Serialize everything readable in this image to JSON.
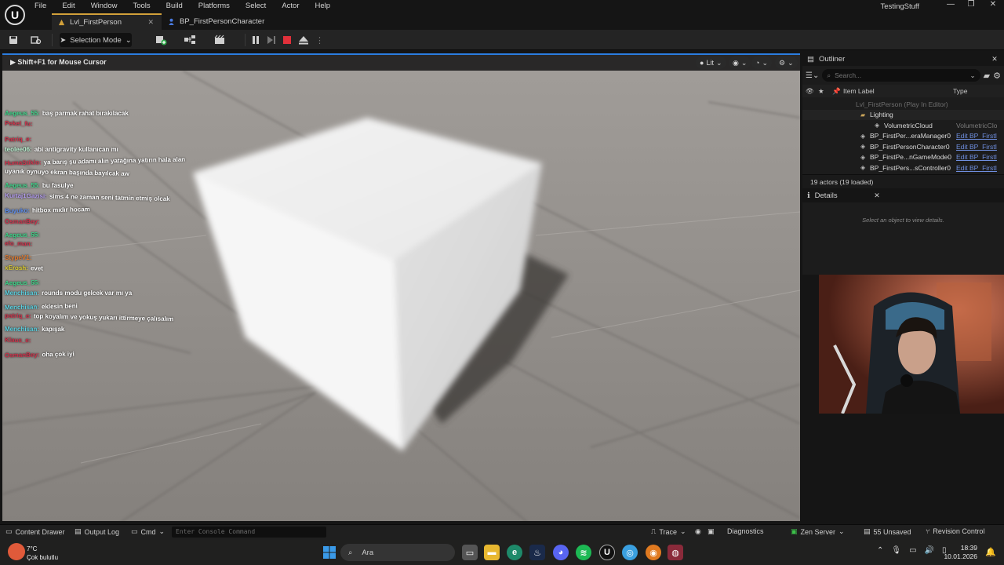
{
  "menu": [
    "File",
    "Edit",
    "Window",
    "Tools",
    "Build",
    "Platforms",
    "Select",
    "Actor",
    "Help"
  ],
  "project_name": "TestingStuff",
  "window_controls": {
    "minimize": "—",
    "maximize": "❐",
    "close": "✕"
  },
  "tabs": [
    {
      "label": "Lvl_FirstPerson",
      "active": true
    },
    {
      "label": "BP_FirstPersonCharacter",
      "active": false
    }
  ],
  "toolbar": {
    "selection_mode": "Selection Mode"
  },
  "viewport": {
    "hint": "Shift+F1 for Mouse Cursor",
    "lit_label": "Lit"
  },
  "chat": [
    {
      "user": "Aegeus_55:",
      "msg": "baş parmak rahat bırakılacak",
      "color": "#3cd68a"
    },
    {
      "user": "Pekel_fu:",
      "msg": "",
      "color": "#d0304a"
    },
    {
      "user": "Patriq_e:",
      "msg": "",
      "color": "#d0304a"
    },
    {
      "user": "teolee06:",
      "msg": "abi antigravity kullanıcan mı",
      "color": "#b9f0d0"
    },
    {
      "user": "HumaStiklo:",
      "msg": "ya barış şu adamı alın yatağına yatırın hala alan",
      "color": "#d0304a"
    },
    {
      "user": "",
      "msg": "uyanık oynuyo ekran başında bayılcak aw",
      "color": "#ffffff"
    },
    {
      "user": "Aegeus_55:",
      "msg": "bu fasulye",
      "color": "#3cd68a"
    },
    {
      "user": "Kurtaj1Gazisi:",
      "msg": "sims 4 ne zaman seni tatmin etmiş olcak",
      "color": "#b39cf0"
    },
    {
      "user": "Buyuko:",
      "msg": "hitbox mıdır hocam",
      "color": "#5a8cf0"
    },
    {
      "user": "OsmanBey:",
      "msg": "",
      "color": "#d0304a"
    },
    {
      "user": "Aegeus_55:",
      "msg": "",
      "color": "#3cd68a"
    },
    {
      "user": "elo_man:",
      "msg": "",
      "color": "#d0304a"
    },
    {
      "user": "StypeV1:",
      "msg": "",
      "color": "#e07a30"
    },
    {
      "user": "xErosh:",
      "msg": "evet",
      "color": "#e0d030"
    },
    {
      "user": "Aegeus_55:",
      "msg": "",
      "color": "#3cd68a"
    },
    {
      "user": "Menchisan:",
      "msg": "rounds modu gelcek var mı ya",
      "color": "#5ad0e0"
    },
    {
      "user": "Menchisan:",
      "msg": "eklesin beni",
      "color": "#5ad0e0"
    },
    {
      "user": "patriq_e:",
      "msg": "top koyalım ve yokuş yukarı ittirmeye çalısalım",
      "color": "#d0304a"
    },
    {
      "user": "Menchisan:",
      "msg": "kapışak",
      "color": "#5ad0e0"
    },
    {
      "user": "Klaus_e:",
      "msg": "",
      "color": "#d0304a"
    },
    {
      "user": "OsmanBey:",
      "msg": "oha çok iyi",
      "color": "#d0304a"
    }
  ],
  "outliner": {
    "title": "Outliner",
    "search_placeholder": "Search...",
    "col_label": "Item Label",
    "col_type": "Type",
    "rows": [
      {
        "label": "Lvl_FirstPerson (Play In Editor)",
        "type": "",
        "indent": 2,
        "dim": true
      },
      {
        "label": "Lighting",
        "type": "",
        "indent": 3,
        "folder": true
      },
      {
        "label": "VolumetricCloud",
        "type": "VolumetricClo",
        "indent": 4,
        "plain": true
      },
      {
        "label": "BP_FirstPer...eraManager0",
        "type": "Edit BP_FirstI",
        "indent": 3
      },
      {
        "label": "BP_FirstPersonCharacter0",
        "type": "Edit BP_FirstI",
        "indent": 3
      },
      {
        "label": "BP_FirstPe...nGameMode0",
        "type": "Edit BP_FirstI",
        "indent": 3
      },
      {
        "label": "BP_FirstPers...sController0",
        "type": "Edit BP_FirstI",
        "indent": 3
      }
    ],
    "actors": "19 actors (19 loaded)"
  },
  "details": {
    "title": "Details",
    "empty": "Select an object to view details."
  },
  "bottombar": {
    "content_drawer": "Content Drawer",
    "output_log": "Output Log",
    "cmd": "Cmd",
    "console_placeholder": "Enter Console Command",
    "trace": "Trace",
    "diagnostics": "Diagnostics",
    "zen_server": "Zen Server",
    "unsaved": "55 Unsaved",
    "revision_control": "Revision Control"
  },
  "taskbar": {
    "weather_temp": "7°C",
    "weather_desc": "Çok bulutlu",
    "search": "Ara",
    "time": "18:39",
    "date": "10.01.2026",
    "colors": {
      "ue_accent": "#d2a13a",
      "selection_blue": "#2b7de0"
    }
  }
}
